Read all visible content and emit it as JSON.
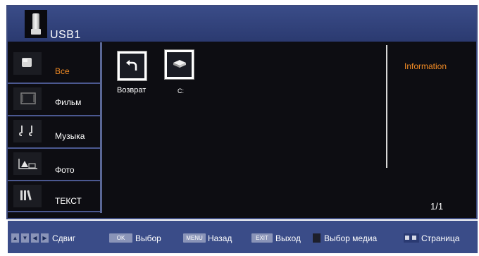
{
  "header": {
    "title": "USB1",
    "icon": "usb-drive-icon"
  },
  "sidebar": {
    "items": [
      {
        "label": "Все",
        "icon": "all-files-icon",
        "active": true
      },
      {
        "label": "Фильм",
        "icon": "film-icon",
        "active": false
      },
      {
        "label": "Музыка",
        "icon": "music-icon",
        "active": false
      },
      {
        "label": "Фото",
        "icon": "photo-icon",
        "active": false
      },
      {
        "label": "ТЕКСТ",
        "icon": "books-icon",
        "active": false
      }
    ]
  },
  "main": {
    "items": [
      {
        "label": "Возврат",
        "icon": "back-arrow-icon"
      },
      {
        "label": "C:",
        "icon": "drive-icon"
      }
    ]
  },
  "info": {
    "title": "Information",
    "page": "1/1"
  },
  "hints": {
    "move": "Сдвиг",
    "ok_key": "OK",
    "ok": "Выбор",
    "menu_key": "MENU",
    "menu": "Назад",
    "exit_key": "EXIT",
    "exit": "Выход",
    "media": "Выбор медиа",
    "page": "Страница"
  },
  "colors": {
    "accent": "#f08a24",
    "bar": "#3a4c88",
    "background": "#0d0d12"
  }
}
